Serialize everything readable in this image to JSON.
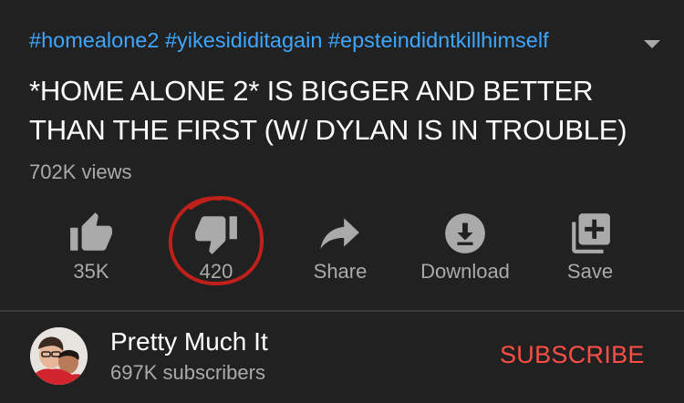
{
  "video": {
    "hashtags": [
      "#homealone2",
      "#yikesididitagain",
      "#epsteindidntkillhimself"
    ],
    "title": "*HOME ALONE 2* IS BIGGER AND BETTER THAN THE FIRST (W/ DYLAN IS IN TROUBLE)",
    "views": "702K views"
  },
  "actions": {
    "like": {
      "label": "35K",
      "icon": "thumbs-up-icon"
    },
    "dislike": {
      "label": "420",
      "icon": "thumbs-down-icon"
    },
    "share": {
      "label": "Share",
      "icon": "share-arrow-icon"
    },
    "download": {
      "label": "Download",
      "icon": "download-icon"
    },
    "save": {
      "label": "Save",
      "icon": "playlist-add-icon"
    }
  },
  "annotation": {
    "color": "#c0201a",
    "shape": "hand-drawn circle around dislike count"
  },
  "channel": {
    "name": "Pretty Much It",
    "subscribers": "697K subscribers",
    "subscribe_label": "SUBSCRIBE"
  },
  "colors": {
    "background": "#212121",
    "link": "#3ea6ff",
    "secondary_text": "#aaaaaa",
    "subscribe": "#ff4e45",
    "icon": "#aaaaaa"
  }
}
